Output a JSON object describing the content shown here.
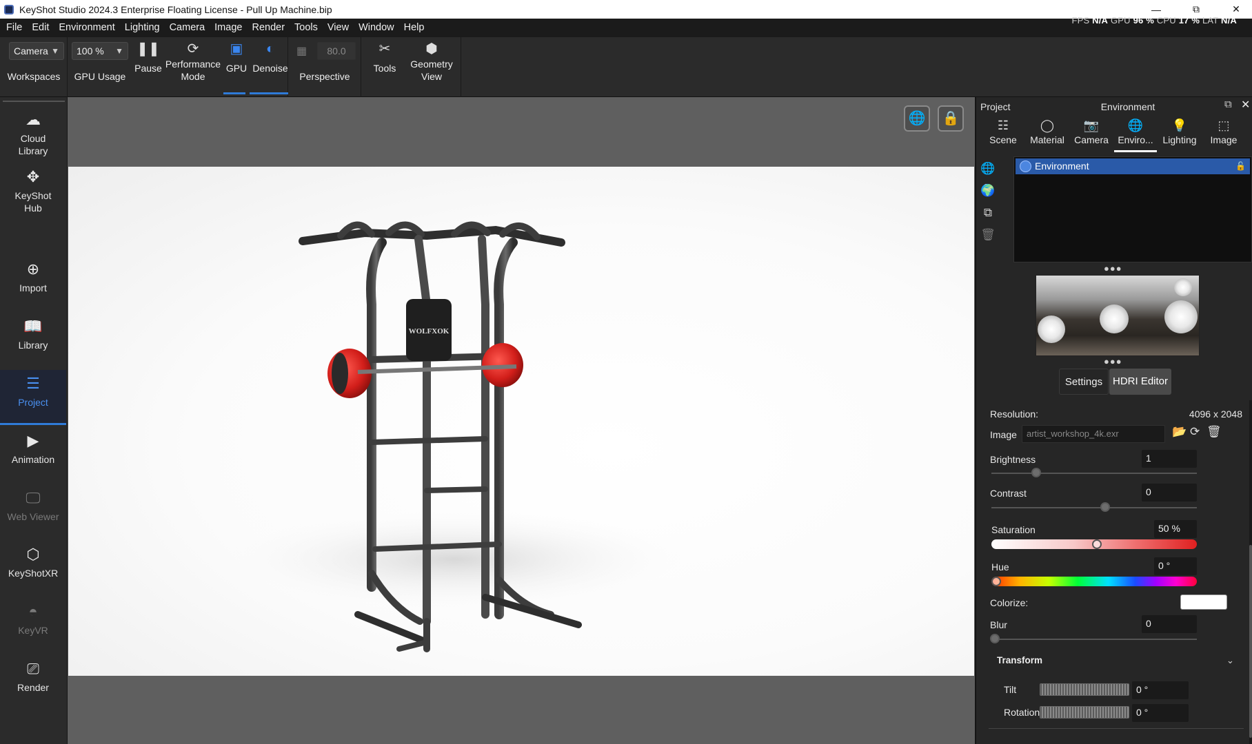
{
  "window": {
    "title": "KeyShot Studio 2024.3 Enterprise Floating License  - Pull Up Machine.bip",
    "minimize_glyph": "—",
    "restore_glyph": "⧉",
    "close_glyph": "✕"
  },
  "menu": [
    "File",
    "Edit",
    "Environment",
    "Lighting",
    "Camera",
    "Image",
    "Render",
    "Tools",
    "View",
    "Window",
    "Help"
  ],
  "stats": {
    "fps_label": "FPS",
    "fps": "N/A",
    "gpu_label": "GPU",
    "gpu": "96 %",
    "cpu_label": "CPU",
    "cpu": "17 %",
    "lat_label": "LAT",
    "lat": "N/A"
  },
  "toolbar": {
    "workspace_select": "Camera",
    "workspaces_label": "Workspaces",
    "gpu_usage_select": "100 %",
    "gpu_usage_label": "GPU Usage",
    "pause_label": "Pause",
    "performance_label_1": "Performance",
    "performance_label_2": "Mode",
    "gpu_label": "GPU",
    "denoise_label": "Denoise",
    "perspective_value": "80.0",
    "perspective_label": "Perspective",
    "tools_label": "Tools",
    "geometry_label_1": "Geometry",
    "geometry_label_2": "View",
    "accent": "#2f7bd8"
  },
  "sidebar": {
    "items": [
      {
        "label_1": "Cloud",
        "label_2": "Library",
        "icon": "cloud-icon"
      },
      {
        "label_1": "KeyShot",
        "label_2": "Hub",
        "icon": "hub-icon"
      },
      {
        "label_1": "Import",
        "icon": "import-icon"
      },
      {
        "label_1": "Library",
        "icon": "book-icon"
      },
      {
        "label_1": "Project",
        "icon": "project-icon"
      },
      {
        "label_1": "Animation",
        "icon": "play-icon"
      },
      {
        "label_1": "Web Viewer",
        "icon": "monitor-icon"
      },
      {
        "label_1": "KeyShotXR",
        "icon": "cube-icon"
      },
      {
        "label_1": "KeyVR",
        "icon": "vr-icon"
      },
      {
        "label_1": "Render",
        "icon": "render-icon"
      }
    ]
  },
  "viewport": {
    "brand_text": "WOLFXOK"
  },
  "panel": {
    "project_label": "Project",
    "header_title": "Environment",
    "tabs": [
      {
        "label": "Scene",
        "icon": "list-icon"
      },
      {
        "label": "Material",
        "icon": "material-icon"
      },
      {
        "label": "Camera",
        "icon": "camera-icon"
      },
      {
        "label": "Enviro...",
        "icon": "globe-icon"
      },
      {
        "label": "Lighting",
        "icon": "bulb-icon"
      },
      {
        "label": "Image",
        "icon": "frame-icon"
      }
    ],
    "env_item": "Environment",
    "dots": "●●●",
    "settings_label": "Settings",
    "hdri_editor_label": "HDRI Editor",
    "resolution_label": "Resolution:",
    "resolution_value": "4096 x 2048",
    "image_label": "Image",
    "image_value": "artist_workshop_4k.exr",
    "brightness_label": "Brightness",
    "brightness_value": "1",
    "contrast_label": "Contrast",
    "contrast_value": "0",
    "saturation_label": "Saturation",
    "saturation_value": "50 %",
    "hue_label": "Hue",
    "hue_value": "0 °",
    "colorize_label": "Colorize:",
    "colorize_color": "#ffffff",
    "blur_label": "Blur",
    "blur_value": "0",
    "transform_label": "Transform",
    "tilt_label": "Tilt",
    "tilt_value": "0 °",
    "rotation_label": "Rotation",
    "rotation_value": "0 °"
  }
}
